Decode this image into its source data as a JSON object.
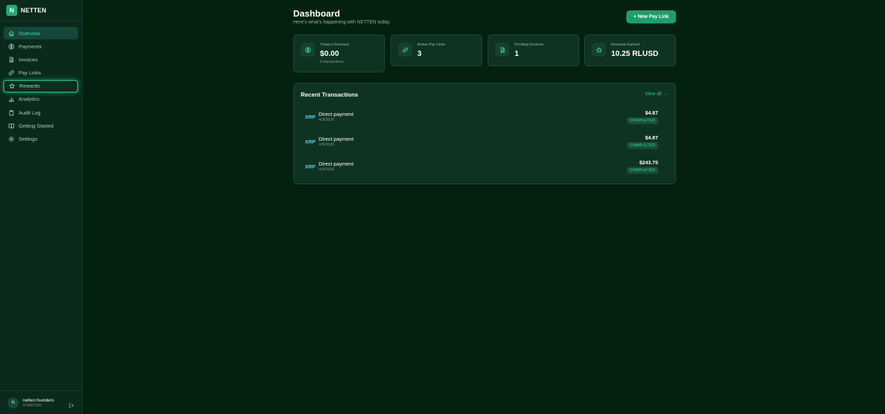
{
  "brand": {
    "logo_letter": "N",
    "name": "NETTEN"
  },
  "sidebar": {
    "items": [
      {
        "label": "Overview",
        "icon": "home-icon"
      },
      {
        "label": "Payments",
        "icon": "dollar-circle-icon"
      },
      {
        "label": "Invoices",
        "icon": "file-icon"
      },
      {
        "label": "Pay Links",
        "icon": "link-icon"
      },
      {
        "label": "Rewards",
        "icon": "star-icon"
      },
      {
        "label": "Analytics",
        "icon": "bar-chart-icon"
      },
      {
        "label": "Audit Log",
        "icon": "clipboard-icon"
      },
      {
        "label": "Getting Started",
        "icon": "book-icon"
      },
      {
        "label": "Settings",
        "icon": "gear-icon"
      }
    ],
    "active": "Overview",
    "focused": "Rewards"
  },
  "user": {
    "avatar_letter": "N",
    "name": "netten.founders",
    "plan": "STARTER"
  },
  "header": {
    "title": "Dashboard",
    "subtitle": "Here's what's happening with NETTEN today.",
    "new_button": "+ New Pay Link"
  },
  "stats": [
    {
      "label": "Today's Revenue",
      "value": "$0.00",
      "sub": "0 transactions",
      "icon": "dollar-circle-icon"
    },
    {
      "label": "Active Pay Links",
      "value": "3",
      "icon": "link-icon"
    },
    {
      "label": "Pending Invoices",
      "value": "1",
      "icon": "file-icon"
    },
    {
      "label": "Rewards Earned",
      "value": "10.25 RLUSD",
      "icon": "star-icon"
    }
  ],
  "transactions": {
    "title": "Recent Transactions",
    "view_all": "View all →",
    "items": [
      {
        "currency": "XRP",
        "description": "Direct payment",
        "date": "4/3/2026",
        "amount": "$4.87",
        "status": "COMPLETED"
      },
      {
        "currency": "XRP",
        "description": "Direct payment",
        "date": "4/3/2026",
        "amount": "$4.87",
        "status": "COMPLETED"
      },
      {
        "currency": "XRP",
        "description": "Direct payment",
        "date": "4/3/2026",
        "amount": "$243.75",
        "status": "COMPLETED"
      }
    ]
  },
  "colors": {
    "accent": "#1f9d6f",
    "accent_text": "#4ed8a1",
    "background": "#04200f",
    "card": "#0f3322",
    "currency": "#5cc9e8"
  }
}
